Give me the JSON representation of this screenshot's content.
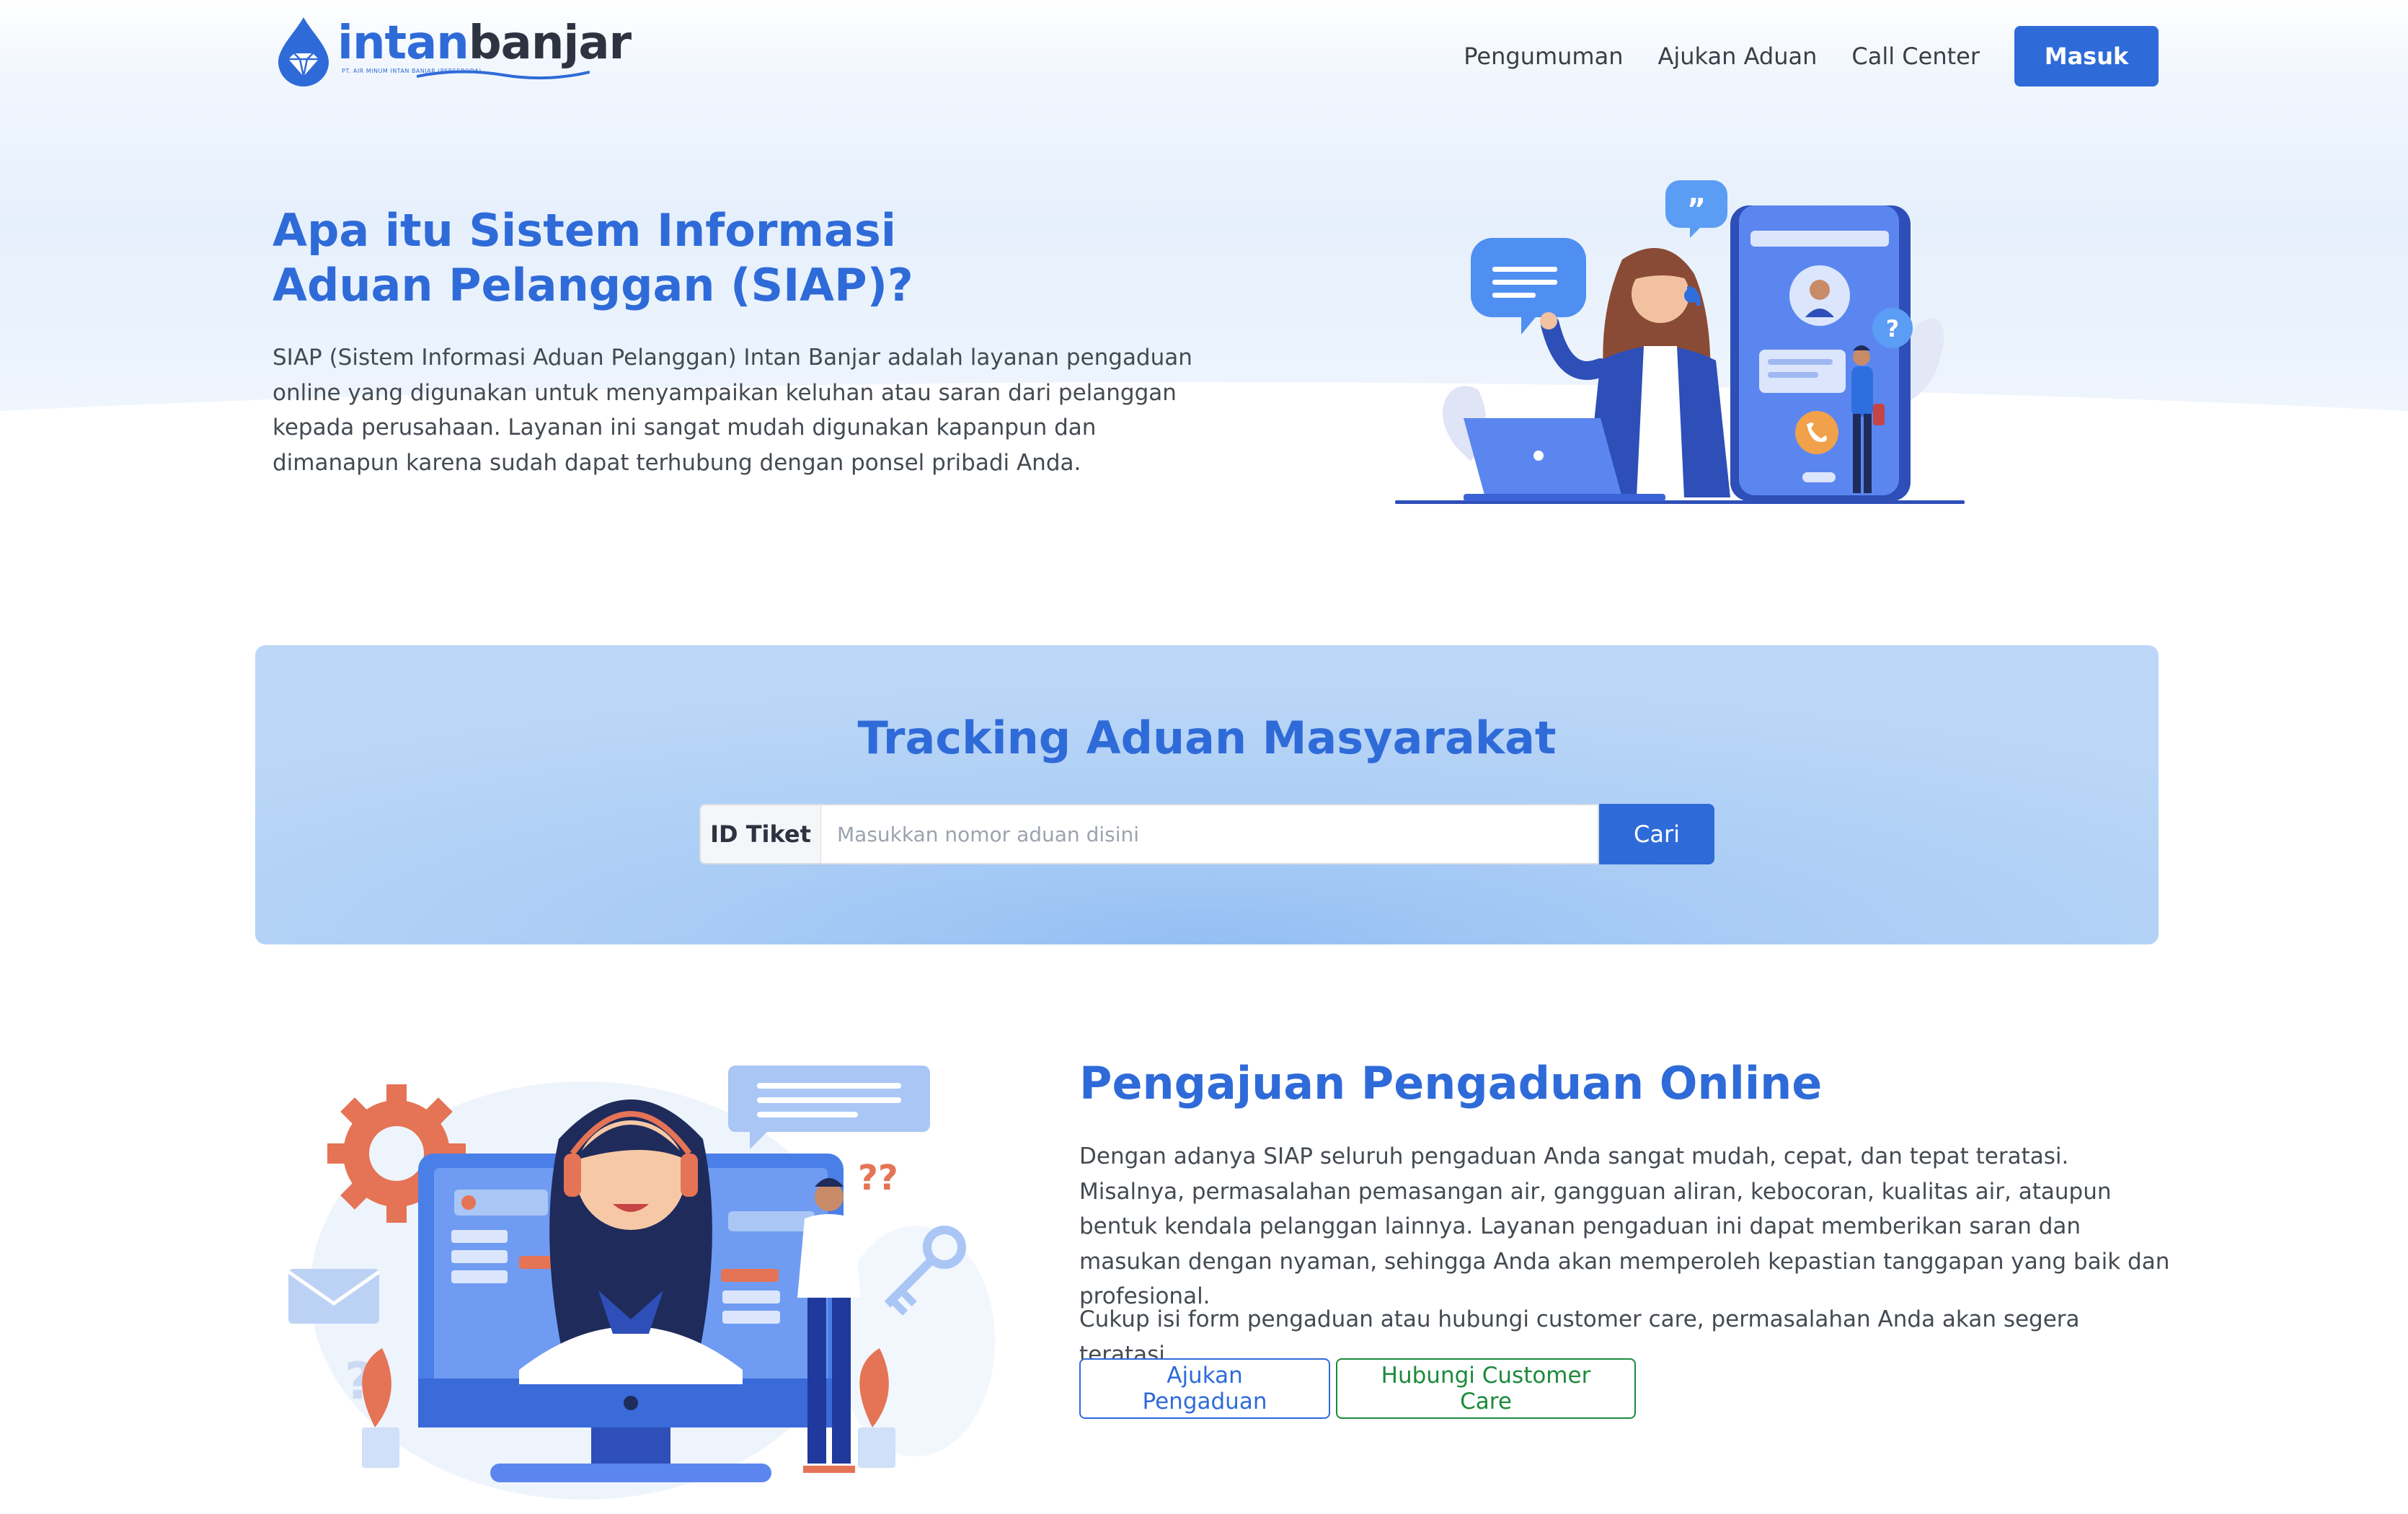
{
  "brand": {
    "word_part1": "intan",
    "word_part2": "banjar",
    "tagline": "PT. AIR MINUM INTAN BANJAR (PERSERODA)"
  },
  "nav": {
    "links": [
      "Pengumuman",
      "Ajukan Aduan",
      "Call Center"
    ],
    "login_label": "Masuk"
  },
  "hero": {
    "title": "Apa itu Sistem Informasi Aduan Pelanggan (SIAP)?",
    "description": "SIAP (Sistem Informasi Aduan Pelanggan) Intan Banjar adalah layanan pengaduan online yang digunakan untuk menyampaikan keluhan atau saran dari pelanggan kepada perusahaan. Layanan ini sangat mudah digunakan kapanpun dan dimanapun karena sudah dapat terhubung dengan ponsel pribadi Anda."
  },
  "tracking": {
    "title": "Tracking Aduan Masyarakat",
    "id_label": "ID Tiket",
    "input_value": "",
    "input_placeholder": "Masukkan nomor aduan disini",
    "search_label": "Cari"
  },
  "complaints": {
    "title": "Pengajuan Pengaduan Online",
    "paragraph1": "Dengan adanya SIAP seluruh pengaduan Anda sangat mudah, cepat, dan tepat teratasi. Misalnya, permasalahan pemasangan air, gangguan aliran, kebocoran, kualitas air, ataupun bentuk kendala pelanggan lainnya. Layanan pengaduan ini dapat memberikan saran dan masukan dengan nyaman, sehingga Anda akan memperoleh kepastian tanggapan yang baik dan profesional.",
    "paragraph2": "Cukup isi form pengaduan atau hubungi customer care, permasalahan Anda akan segera teratasi.",
    "button_submit": "Ajukan Pengaduan",
    "button_contact": "Hubungi Customer Care"
  },
  "icons": {
    "logo": "water-drop-diamond-icon",
    "hero_illustration": "customer-service-phone-illustration",
    "section_illustration": "call-center-agent-illustration"
  },
  "colors": {
    "primary": "#2f6bd8",
    "success": "#1d8a3b",
    "text": "#444a52",
    "tracking_bg": "#a9ccf5"
  }
}
